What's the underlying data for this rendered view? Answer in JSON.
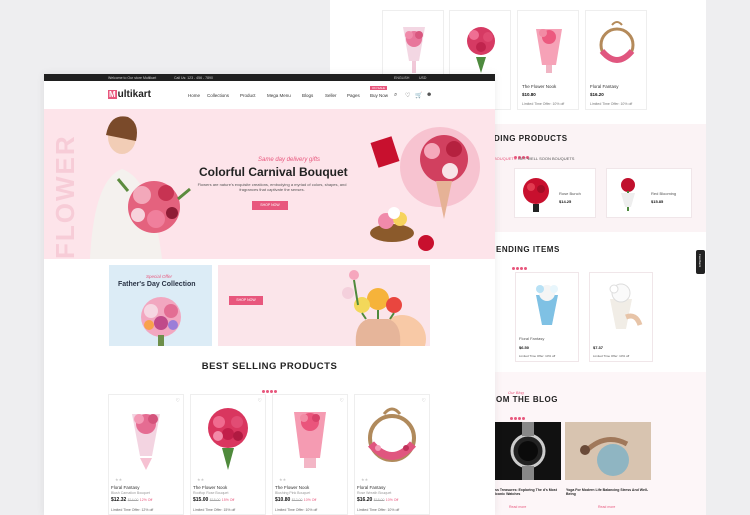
{
  "colors": {
    "accent": "#e8577d",
    "hero_bg": "#fde4ea",
    "topbar": "#1f1f1f"
  },
  "topbar": {
    "welcome": "Welcome to Our store Multikart",
    "phone": "Call Us: 123 - 456 - 7890",
    "language": "ENGLISH",
    "currency": "USD"
  },
  "nav": {
    "logo_letter": "M",
    "logo_rest": "ultikart",
    "items": [
      "Home",
      "Collections",
      "Product",
      "Mega Menu",
      "Blogs",
      "Seller",
      "Pages",
      "Buy Now"
    ],
    "badge": "ON SALE",
    "icons": [
      "search-icon",
      "heart-icon",
      "cart-icon",
      "user-icon"
    ]
  },
  "hero": {
    "vertical_text": "FLOWER",
    "subtitle": "Same day delivery gifts",
    "title": "Colorful Carnival Bouquet",
    "description": "Flowers are nature's exquisite creations, embodying a myriad of colors, shapes, and fragrances that captivate the senses.",
    "button": "SHOP NOW"
  },
  "promos": {
    "left_special": "Special Offer",
    "left_title": "Father's Day Collection",
    "right_button": "SHOP NOW"
  },
  "best_selling": {
    "title": "BEST SELLING PRODUCTS",
    "products": [
      {
        "name": "Floral Fantasy",
        "sub": "Blush Carnation Bouquet",
        "price": "$12.32",
        "old": "$14.00",
        "off": "12% Off",
        "limited": "Limited Time Offer: 12% off"
      },
      {
        "name": "The Flower Nook",
        "sub": "Rooftop Rose Bouquet",
        "price": "$15.00",
        "old": "$18.00",
        "off": "15% Off",
        "limited": "Limited Time Offer: 15% off"
      },
      {
        "name": "The Flower Nook",
        "sub": "Blushing Pink Bouquet",
        "price": "$10.80",
        "old": "$12.00",
        "off": "10% Off",
        "limited": "Limited Time Offer: 10% off"
      },
      {
        "name": "Floral Fantasy",
        "sub": "Rose Wreath Bouquet",
        "price": "$16.20",
        "old": "$18.00",
        "off": "10% Off",
        "limited": "Limited Time Offer: 10% off"
      }
    ]
  },
  "back_page": {
    "cards": [
      {
        "name": "",
        "price": "",
        "limited": ""
      },
      {
        "name": "",
        "price": "",
        "limited": ""
      },
      {
        "name": "The Flower Nook",
        "price": "$10.80",
        "limited": "Limited Time Offer: 10% off"
      },
      {
        "name": "Floral Fantasy",
        "price": "$16.20",
        "limited": "Limited Time Offer: 10% off"
      }
    ],
    "trending_products_title": "DING PRODUCTS",
    "trending_tabs": [
      "BOUQUETS",
      "GET WELL SOON BOUQUETS"
    ],
    "trending_items": [
      {
        "name": "Rose Bunch",
        "price": "$14.25"
      },
      {
        "name": "Red Blooming",
        "price": "$15.85"
      }
    ],
    "trending_items_title": "ENDING ITEMS",
    "items": [
      {
        "name": "Floral Fantasy",
        "price": "$6.50",
        "limited": "Limited Time Offer: 10% off"
      },
      {
        "name": "Floral Fantasy",
        "price": "$7.37",
        "limited": "Limited Time Offer: 10% off"
      }
    ],
    "blog_label": "Our Blog",
    "blog_title": "OM THE BLOG",
    "blog_posts": [
      {
        "title": "ss Treasures: Exploring The d's Most Iconic Watches",
        "link": "Read more"
      },
      {
        "title": "Yoga For Modern Life Balancing Stress And Well-Being",
        "link": "Read more"
      }
    ],
    "feedback": "Feedback"
  }
}
